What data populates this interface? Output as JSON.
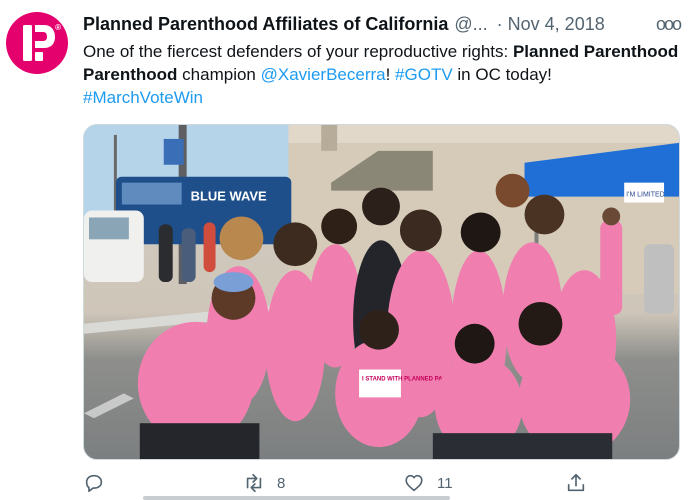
{
  "tweet": {
    "author_name": "Planned Parenthood Affiliates of California",
    "handle": "@...",
    "separator": "·",
    "date": "Nov 4, 2018",
    "more_label": "ooo",
    "text": {
      "part1": "One of the fiercest defenders of your reproductive rights: ",
      "bold_name": "Planned Parenthood",
      "part2": " champion ",
      "mention": "@XavierBecerra",
      "part3": "! ",
      "hashtag1": "#GOTV",
      "part4": " in OC today! ",
      "hashtag2": "#MarchVoteWin"
    },
    "photo": {
      "banner_text": "BLUE WAVE",
      "tent_sign": "I'M LIMITED",
      "shirt_text": "I STAND WITH PLANNED PARENTHOOD"
    },
    "actions": {
      "reply_count": "",
      "retweet_count": "8",
      "like_count": "11"
    }
  },
  "colors": {
    "brand_pink": "#e4006d",
    "link_blue": "#1d9bf0",
    "secondary_text": "#536471",
    "shirt_pink": "#f06fa4"
  },
  "icons": {
    "avatar": "planned-parenthood-logo-icon",
    "reply": "reply-icon",
    "retweet": "retweet-icon",
    "like": "heart-icon",
    "share": "share-icon"
  }
}
